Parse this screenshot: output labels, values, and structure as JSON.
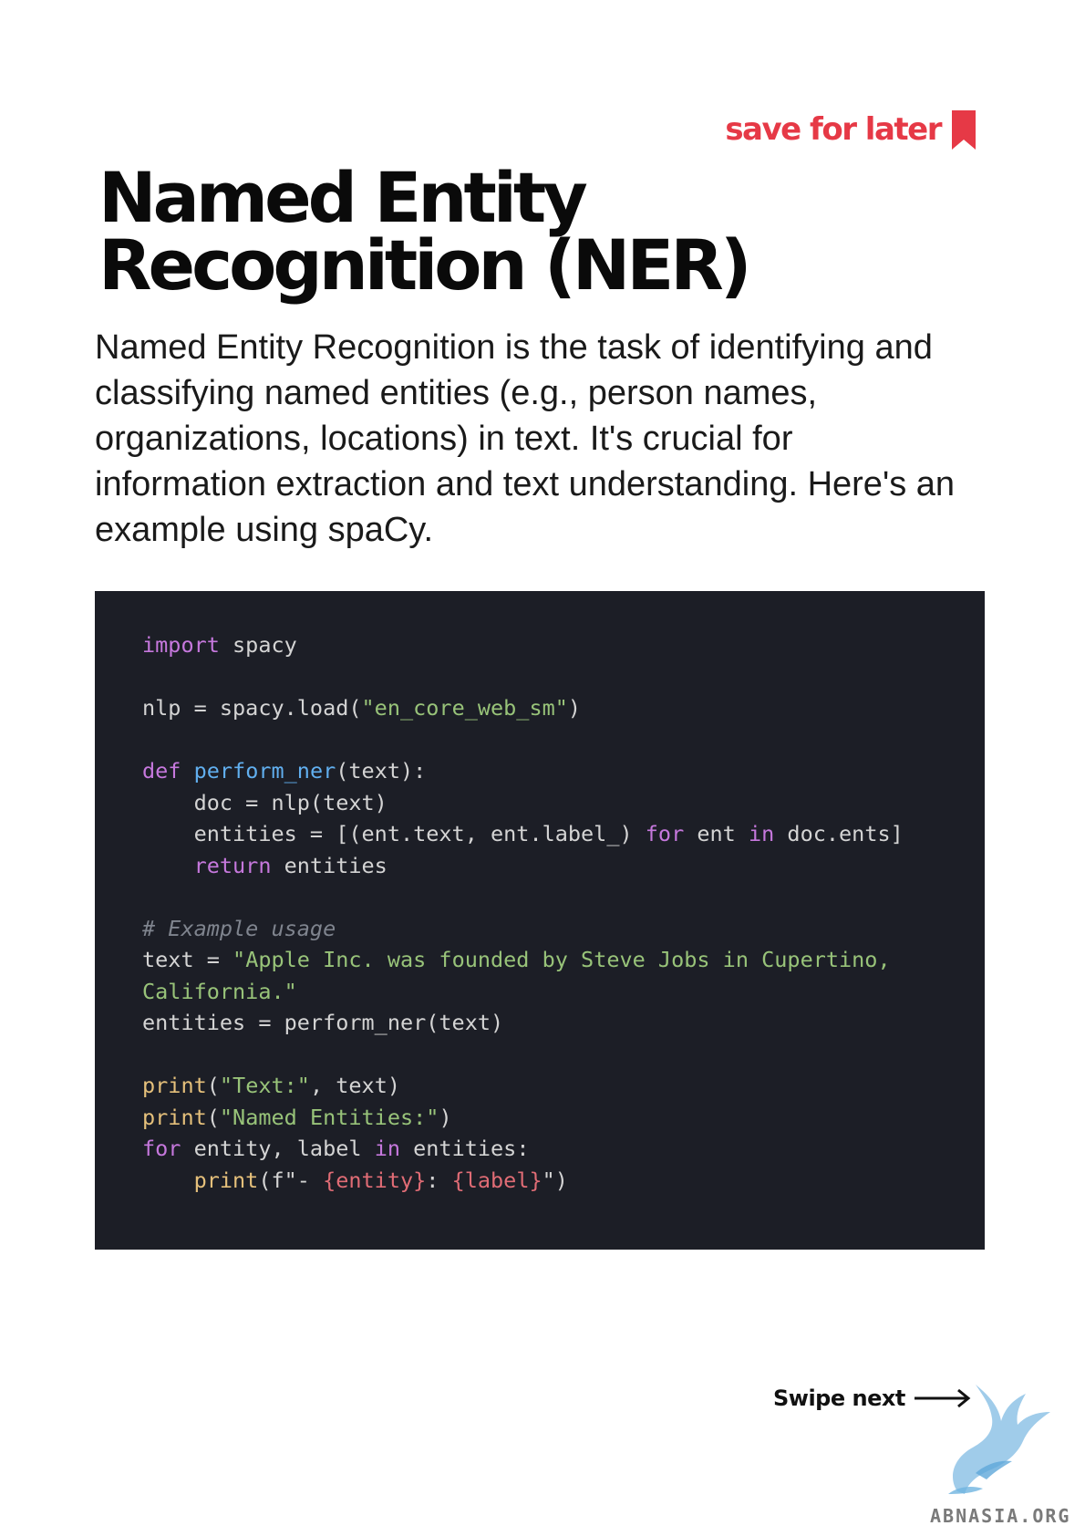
{
  "header": {
    "save_label": "save for later",
    "accent_color": "#e63946",
    "icon": "bookmark-icon"
  },
  "title": "Named Entity Recognition (NER)",
  "intro": "Named Entity Recognition is the task of identifying and classifying named entities (e.g., person names, organizations, locations) in text. It's crucial for information extraction and text understanding. Here's an example using spaCy.",
  "code": {
    "language": "python",
    "background": "#1c1e26",
    "lines": [
      [
        {
          "t": "import",
          "k": "kw"
        },
        {
          "t": " spacy",
          "k": "pl"
        }
      ],
      [],
      [
        {
          "t": "nlp = spacy.load(",
          "k": "pl"
        },
        {
          "t": "\"en_core_web_sm\"",
          "k": "str"
        },
        {
          "t": ")",
          "k": "pl"
        }
      ],
      [],
      [
        {
          "t": "def",
          "k": "kw"
        },
        {
          "t": " ",
          "k": "pl"
        },
        {
          "t": "perform_ner",
          "k": "fn"
        },
        {
          "t": "(text):",
          "k": "pl"
        }
      ],
      [
        {
          "t": "    doc = nlp(text)",
          "k": "pl"
        }
      ],
      [
        {
          "t": "    entities = [(ent.text, ent.label_) ",
          "k": "pl"
        },
        {
          "t": "for",
          "k": "kw"
        },
        {
          "t": " ent ",
          "k": "pl"
        },
        {
          "t": "in",
          "k": "kw"
        },
        {
          "t": " doc.ents]",
          "k": "pl"
        }
      ],
      [
        {
          "t": "    ",
          "k": "pl"
        },
        {
          "t": "return",
          "k": "kw"
        },
        {
          "t": " entities",
          "k": "pl"
        }
      ],
      [],
      [
        {
          "t": "# Example usage",
          "k": "cm"
        }
      ],
      [
        {
          "t": "text = ",
          "k": "pl"
        },
        {
          "t": "\"Apple Inc. was founded by Steve Jobs in Cupertino,",
          "k": "str"
        }
      ],
      [
        {
          "t": "California.\"",
          "k": "str"
        }
      ],
      [
        {
          "t": "entities = perform_ner(text)",
          "k": "pl"
        }
      ],
      [],
      [
        {
          "t": "print",
          "k": "bi"
        },
        {
          "t": "(",
          "k": "pl"
        },
        {
          "t": "\"Text:\"",
          "k": "str"
        },
        {
          "t": ", text)",
          "k": "pl"
        }
      ],
      [
        {
          "t": "print",
          "k": "bi"
        },
        {
          "t": "(",
          "k": "pl"
        },
        {
          "t": "\"Named Entities:\"",
          "k": "str"
        },
        {
          "t": ")",
          "k": "pl"
        }
      ],
      [
        {
          "t": "for",
          "k": "kw"
        },
        {
          "t": " entity, label ",
          "k": "pl"
        },
        {
          "t": "in",
          "k": "kw"
        },
        {
          "t": " entities:",
          "k": "pl"
        }
      ],
      [
        {
          "t": "    ",
          "k": "pl"
        },
        {
          "t": "print",
          "k": "bi"
        },
        {
          "t": "(f\"- ",
          "k": "pl"
        },
        {
          "t": "{entity}",
          "k": "var"
        },
        {
          "t": ": ",
          "k": "pl"
        },
        {
          "t": "{label}",
          "k": "var"
        },
        {
          "t": "\")",
          "k": "pl"
        }
      ]
    ]
  },
  "footer": {
    "swipe_label": "Swipe next",
    "icon": "arrow-right-icon"
  },
  "watermark": {
    "text": "ABNASIA.ORG",
    "icon": "dragon-logo-icon"
  }
}
